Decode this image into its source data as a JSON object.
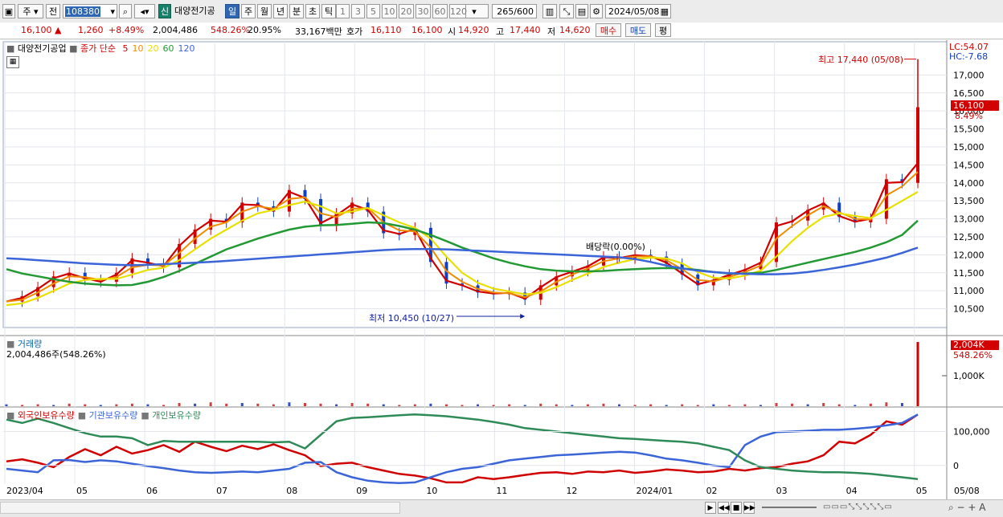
{
  "toolbar": {
    "market": "주",
    "scope": "전",
    "code": "108380",
    "credit_badge": "신",
    "stock_name": "대양전기공",
    "periods": [
      "일",
      "주",
      "월",
      "년",
      "분",
      "초",
      "틱"
    ],
    "active_period": "일",
    "intervals": [
      "1",
      "3",
      "5",
      "10",
      "20",
      "30",
      "60",
      "120"
    ],
    "count": "265",
    "count_total": "/600",
    "date": "2024/05/08"
  },
  "quote": {
    "price": "16,100",
    "change": "1,260",
    "change_pct": "+8.49%",
    "volume": "2,004,486",
    "volume_ratio": "548.26%",
    "turnover": "20.95%",
    "amount": "33,167백만",
    "ask_label": "호가",
    "ask1": "16,110",
    "ask2": "16,100",
    "open_label": "시",
    "open": "14,920",
    "high_label": "고",
    "high": "17,440",
    "low_label": "저",
    "low": "14,620",
    "buy": "매수",
    "sell": "매도",
    "eval": "평"
  },
  "legend": {
    "name": "대양전기공업",
    "type": "종가 단순",
    "ma": [
      {
        "label": "5",
        "color": "#d00000"
      },
      {
        "label": "10",
        "color": "#f08c00"
      },
      {
        "label": "20",
        "color": "#e8e000"
      },
      {
        "label": "60",
        "color": "#229933"
      },
      {
        "label": "120",
        "color": "#3a64d8"
      }
    ]
  },
  "right_info": {
    "lc": "LC:54.07",
    "hc": "HC:-7.68",
    "current": "16,100",
    "current_pct": "8.49%"
  },
  "annotations": {
    "high": "최고 17,440 (05/08)",
    "low": "최저 10,450 (10/27)",
    "dividend": "배당락(0.00%)"
  },
  "volume_panel": {
    "title": "거래량",
    "value": "2,004,486주(548.26%)",
    "tag": "2,004K",
    "tag_pct": "548.26%"
  },
  "holder_panel": {
    "series": [
      {
        "label": "외국인보유수량",
        "color": "#d00000"
      },
      {
        "label": "기관보유수량",
        "color": "#3a64d8"
      },
      {
        "label": "개인보유수량",
        "color": "#2e8b57"
      }
    ]
  },
  "chart_data": {
    "type": "line",
    "price_axis": [
      "17,000",
      "16,500",
      "16,000",
      "15,500",
      "15,000",
      "14,500",
      "14,000",
      "13,500",
      "13,000",
      "12,500",
      "12,000",
      "11,500",
      "11,000",
      "10,500"
    ],
    "volume_axis": [
      "1,000K"
    ],
    "holder_axis": [
      "100,000",
      "0"
    ],
    "x_labels": [
      "2023/04",
      "05",
      "06",
      "07",
      "08",
      "09",
      "10",
      "11",
      "12",
      "2024/01",
      "02",
      "03",
      "04",
      "05",
      "05/08"
    ],
    "x_ticks": [
      "2023/04",
      "05",
      "06",
      "07",
      "08",
      "09",
      "10",
      "11",
      "12",
      "2024/01",
      "02",
      "03",
      "04",
      "05"
    ],
    "price_close": [
      10700,
      10850,
      11100,
      11400,
      11500,
      11300,
      11250,
      11500,
      11900,
      11750,
      11650,
      12300,
      12700,
      13000,
      12900,
      13450,
      13350,
      13200,
      13800,
      13550,
      12800,
      13150,
      13450,
      13200,
      12600,
      12550,
      12750,
      11800,
      11200,
      11150,
      10950,
      10900,
      10950,
      10750,
      11150,
      11400,
      11550,
      11700,
      11950,
      11900,
      12000,
      11950,
      11750,
      11450,
      11150,
      11300,
      11450,
      11600,
      11800,
      12900,
      12950,
      13250,
      13450,
      13050,
      12900,
      13000,
      14100,
      14000,
      16100
    ],
    "series": [
      {
        "name": "5",
        "values": [
          10700,
          10800,
          11050,
          11350,
          11480,
          11350,
          11250,
          11450,
          11850,
          11780,
          11680,
          12250,
          12650,
          12950,
          12920,
          13400,
          13380,
          13220,
          13750,
          13580,
          12880,
          13100,
          13400,
          13250,
          12680,
          12580,
          12720,
          11900,
          11280,
          11150,
          10980,
          10920,
          10940,
          10780,
          11100,
          11380,
          11530,
          11680,
          11930,
          11910,
          11990,
          11960,
          11780,
          11480,
          11180,
          11290,
          11440,
          11580,
          11780,
          12800,
          12930,
          13230,
          13430,
          13080,
          12920,
          13000,
          14000,
          14020,
          14550
        ]
      },
      {
        "name": "10",
        "values": [
          10700,
          10750,
          10950,
          11200,
          11400,
          11380,
          11300,
          11380,
          11650,
          11720,
          11700,
          12050,
          12450,
          12780,
          12900,
          13200,
          13350,
          13280,
          13550,
          13600,
          13150,
          13050,
          13280,
          13300,
          12900,
          12680,
          12650,
          12200,
          11550,
          11250,
          11050,
          10950,
          10930,
          10820,
          10980,
          11250,
          11450,
          11620,
          11820,
          11900,
          11950,
          11960,
          11850,
          11600,
          11300,
          11260,
          11380,
          11520,
          11700,
          12450,
          12800,
          13100,
          13350,
          13180,
          13000,
          12980,
          13650,
          13900,
          14300
        ]
      },
      {
        "name": "20",
        "values": [
          10600,
          10650,
          10800,
          11000,
          11200,
          11300,
          11330,
          11330,
          11450,
          11580,
          11640,
          11850,
          12150,
          12450,
          12700,
          12950,
          13150,
          13250,
          13380,
          13480,
          13350,
          13150,
          13200,
          13300,
          13100,
          12900,
          12750,
          12450,
          11950,
          11500,
          11220,
          11060,
          10980,
          10900,
          10940,
          11100,
          11300,
          11480,
          11660,
          11780,
          11880,
          11920,
          11900,
          11760,
          11520,
          11360,
          11340,
          11420,
          11560,
          11950,
          12380,
          12750,
          13050,
          13150,
          13080,
          13020,
          13250,
          13500,
          13750
        ]
      },
      {
        "name": "60",
        "values": [
          11600,
          11480,
          11400,
          11320,
          11250,
          11200,
          11170,
          11150,
          11160,
          11250,
          11380,
          11550,
          11750,
          11950,
          12150,
          12300,
          12450,
          12580,
          12700,
          12780,
          12820,
          12830,
          12860,
          12900,
          12880,
          12800,
          12700,
          12550,
          12380,
          12200,
          12050,
          11900,
          11780,
          11680,
          11600,
          11560,
          11540,
          11540,
          11550,
          11580,
          11600,
          11620,
          11630,
          11620,
          11580,
          11520,
          11480,
          11480,
          11500,
          11580,
          11680,
          11780,
          11880,
          11980,
          12080,
          12200,
          12350,
          12550,
          12950
        ]
      },
      {
        "name": "120",
        "values": [
          11900,
          11880,
          11850,
          11820,
          11790,
          11760,
          11740,
          11720,
          11710,
          11720,
          11740,
          11760,
          11780,
          11800,
          11830,
          11860,
          11890,
          11920,
          11950,
          11980,
          12010,
          12040,
          12070,
          12100,
          12130,
          12150,
          12160,
          12160,
          12150,
          12130,
          12110,
          12090,
          12070,
          12050,
          12030,
          12010,
          11990,
          11970,
          11950,
          11930,
          11880,
          11800,
          11700,
          11620,
          11560,
          11520,
          11490,
          11470,
          11460,
          11460,
          11480,
          11520,
          11580,
          11650,
          11730,
          11820,
          11920,
          12050,
          12200
        ]
      }
    ],
    "volume": [
      3,
      2,
      3,
      2,
      4,
      3,
      2,
      3,
      4,
      3,
      2,
      5,
      4,
      6,
      4,
      5,
      4,
      3,
      6,
      5,
      4,
      3,
      5,
      4,
      3,
      2,
      3,
      4,
      3,
      2,
      3,
      2,
      3,
      2,
      4,
      3,
      2,
      3,
      4,
      3,
      2,
      3,
      2,
      3,
      2,
      3,
      2,
      3,
      2,
      5,
      4,
      3,
      5,
      3,
      2,
      4,
      6,
      5,
      100
    ],
    "holders": {
      "foreign": [
        12000,
        18000,
        8000,
        -5000,
        25000,
        48000,
        30000,
        55000,
        35000,
        45000,
        60000,
        40000,
        70000,
        55000,
        42000,
        58000,
        48000,
        62000,
        45000,
        30000,
        -2000,
        5000,
        8000,
        -5000,
        -15000,
        -25000,
        -30000,
        -38000,
        -50000,
        -50000,
        -35000,
        -40000,
        -35000,
        -28000,
        -22000,
        -20000,
        -25000,
        -18000,
        -20000,
        -15000,
        -22000,
        -18000,
        -12000,
        -15000,
        -20000,
        -18000,
        -10000,
        -15000,
        -8000,
        -5000,
        5000,
        12000,
        30000,
        70000,
        65000,
        90000,
        130000,
        120000,
        150000
      ],
      "institution": [
        -10000,
        -15000,
        -20000,
        15000,
        16000,
        10000,
        15000,
        12000,
        5000,
        -2000,
        -8000,
        -15000,
        -20000,
        -22000,
        -20000,
        -18000,
        -20000,
        -15000,
        -10000,
        8000,
        10000,
        -20000,
        -35000,
        -45000,
        -50000,
        -52000,
        -50000,
        -35000,
        -20000,
        -10000,
        -5000,
        5000,
        15000,
        20000,
        25000,
        30000,
        32000,
        35000,
        38000,
        40000,
        38000,
        30000,
        20000,
        15000,
        8000,
        0,
        -5000,
        60000,
        85000,
        98000,
        100000,
        102000,
        105000,
        105000,
        108000,
        112000,
        118000,
        125000,
        150000
      ],
      "individual": [
        135000,
        125000,
        138000,
        125000,
        110000,
        95000,
        85000,
        85000,
        80000,
        60000,
        72000,
        70000,
        70000,
        70000,
        70000,
        70000,
        70000,
        68000,
        70000,
        50000,
        90000,
        130000,
        140000,
        142000,
        145000,
        148000,
        150000,
        148000,
        145000,
        140000,
        135000,
        128000,
        120000,
        110000,
        105000,
        100000,
        95000,
        90000,
        85000,
        80000,
        78000,
        75000,
        72000,
        70000,
        65000,
        55000,
        45000,
        15000,
        -5000,
        -10000,
        -15000,
        -18000,
        -20000,
        -20000,
        -22000,
        -25000,
        -30000,
        -35000,
        -40000
      ]
    },
    "price_ylim": [
      10200,
      17700
    ],
    "holders_ylim": [
      -55000,
      165000
    ]
  }
}
